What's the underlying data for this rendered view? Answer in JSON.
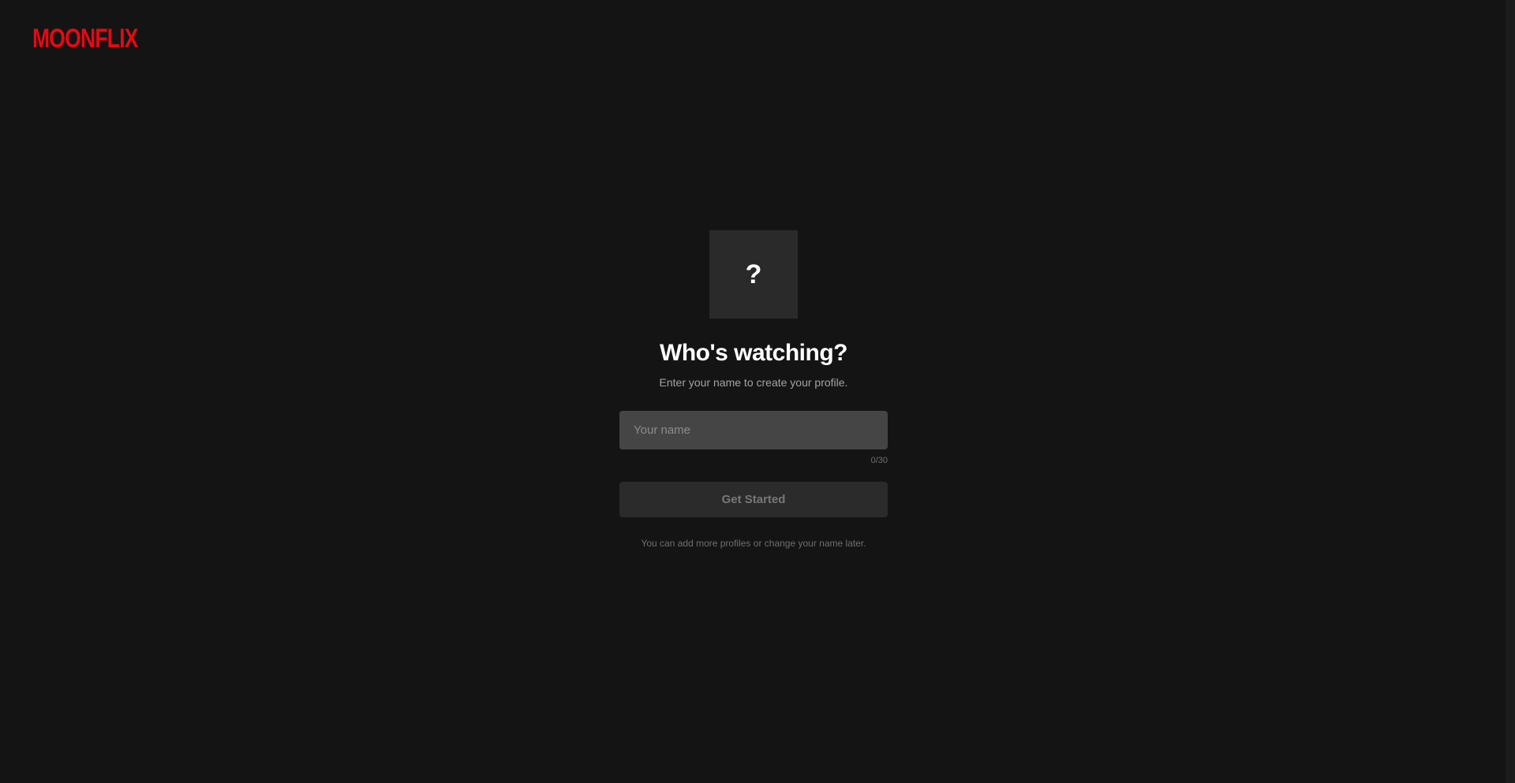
{
  "header": {
    "logo_text": "MOONFLIX"
  },
  "profile": {
    "avatar_glyph": "?",
    "title": "Who's watching?",
    "subtitle": "Enter your name to create your profile.",
    "name_input": {
      "value": "",
      "placeholder": "Your name"
    },
    "char_counter": "0/30",
    "submit_label": "Get Started",
    "footnote": "You can add more profiles or change your name later."
  },
  "colors": {
    "brand": "#e50914",
    "background": "#141414",
    "input_bg": "#454545",
    "button_disabled_bg": "#2b2b2b"
  }
}
